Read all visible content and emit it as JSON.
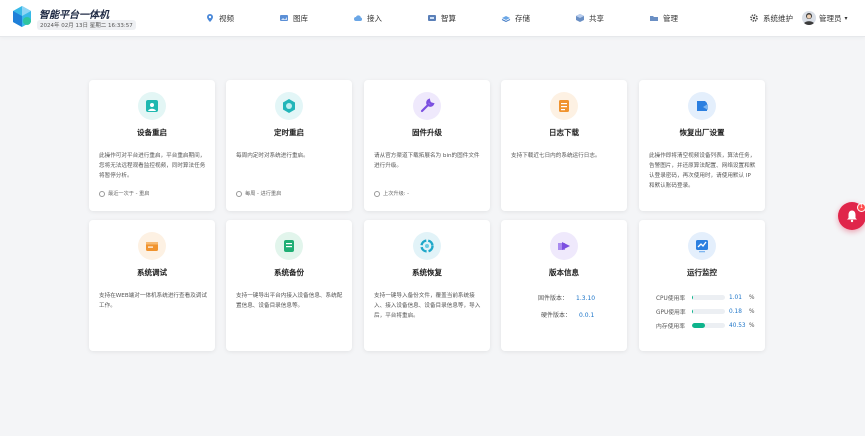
{
  "header": {
    "title": "智能平台一体机",
    "date": "2024年 02月 13日 星期二 16:33:57",
    "nav": [
      {
        "label": "视频",
        "icon": "map-pin-icon"
      },
      {
        "label": "图库",
        "icon": "image-icon"
      },
      {
        "label": "接入",
        "icon": "cloud-icon"
      },
      {
        "label": "智算",
        "icon": "chip-icon"
      },
      {
        "label": "存储",
        "icon": "storage-icon"
      },
      {
        "label": "共享",
        "icon": "share-icon"
      },
      {
        "label": "管理",
        "icon": "folder-icon"
      }
    ],
    "settings_label": "系统维护",
    "user_label": "管理员"
  },
  "cards": [
    {
      "title": "设备重启",
      "desc": "此操作可对平台进行重启，平台重启期间，您将无法远程观看监控视频，同时算法任务将暂停分析。",
      "foot": "最近一次于 - 重启",
      "icon": "device-restart-icon",
      "color": "#1fb8b0"
    },
    {
      "title": "定时重启",
      "desc": "每周内定时对系统进行重启。",
      "foot": "每周 - 进行重启",
      "icon": "timer-restart-icon",
      "color": "#22b5b9"
    },
    {
      "title": "固件升级",
      "desc": "请从官方渠道下载拓展名为 bin的固件文件进行升级。",
      "foot": "上次升级: -",
      "icon": "wrench-icon",
      "color": "#7b4fe0"
    },
    {
      "title": "日志下载",
      "desc": "支持下载近七日内的系统运行日志。",
      "foot": "",
      "icon": "log-icon",
      "color": "#f0932e"
    },
    {
      "title": "恢复出厂设置",
      "desc": "此操作即将清空视频设备列表，算法任务，告警图片，并还原算法配置、网络设置和默认登录密码，再次使用时，请使用默认 IP 和默认账码登录。",
      "foot": "",
      "icon": "factory-reset-icon",
      "color": "#2b7fe0"
    },
    {
      "title": "系统调试",
      "desc": "支持在WEB端对一体机系统进行查看及调试工作。",
      "foot": "",
      "icon": "debug-icon",
      "color": "#f0932e"
    },
    {
      "title": "系统备份",
      "desc": "支持一键导出平台内接入设备信息、系统配置信息、设备目录信息等。",
      "foot": "",
      "icon": "backup-icon",
      "color": "#1fae74"
    },
    {
      "title": "系统恢复",
      "desc": "支持一键导入备份文件，覆盖当前系统接入、接入设备信息、设备目录信息等，导入后，平台将重启。",
      "foot": "",
      "icon": "restore-icon",
      "color": "#1fa8c9"
    },
    {
      "title": "版本信息",
      "desc": "",
      "foot": "",
      "icon": "version-icon",
      "color": "#7b4fe0"
    },
    {
      "title": "运行监控",
      "desc": "",
      "foot": "",
      "icon": "monitor-icon",
      "color": "#2b7fe0"
    }
  ],
  "version": {
    "firmware_label": "固件版本：",
    "firmware_value": "1.3.10",
    "hardware_label": "硬件版本：",
    "hardware_value": "0.0.1"
  },
  "monitor": [
    {
      "label": "CPU使用率",
      "value": "1.01",
      "unit": "%",
      "fraction": 0.0101
    },
    {
      "label": "GPU使用率",
      "value": "0.18",
      "unit": "%",
      "fraction": 0.0018
    },
    {
      "label": "内存使用率",
      "value": "40.53",
      "unit": "%",
      "fraction": 0.4053
    }
  ],
  "alert_badge": "1",
  "accent_color": "#0eb48c",
  "link_color": "#1a73c8"
}
